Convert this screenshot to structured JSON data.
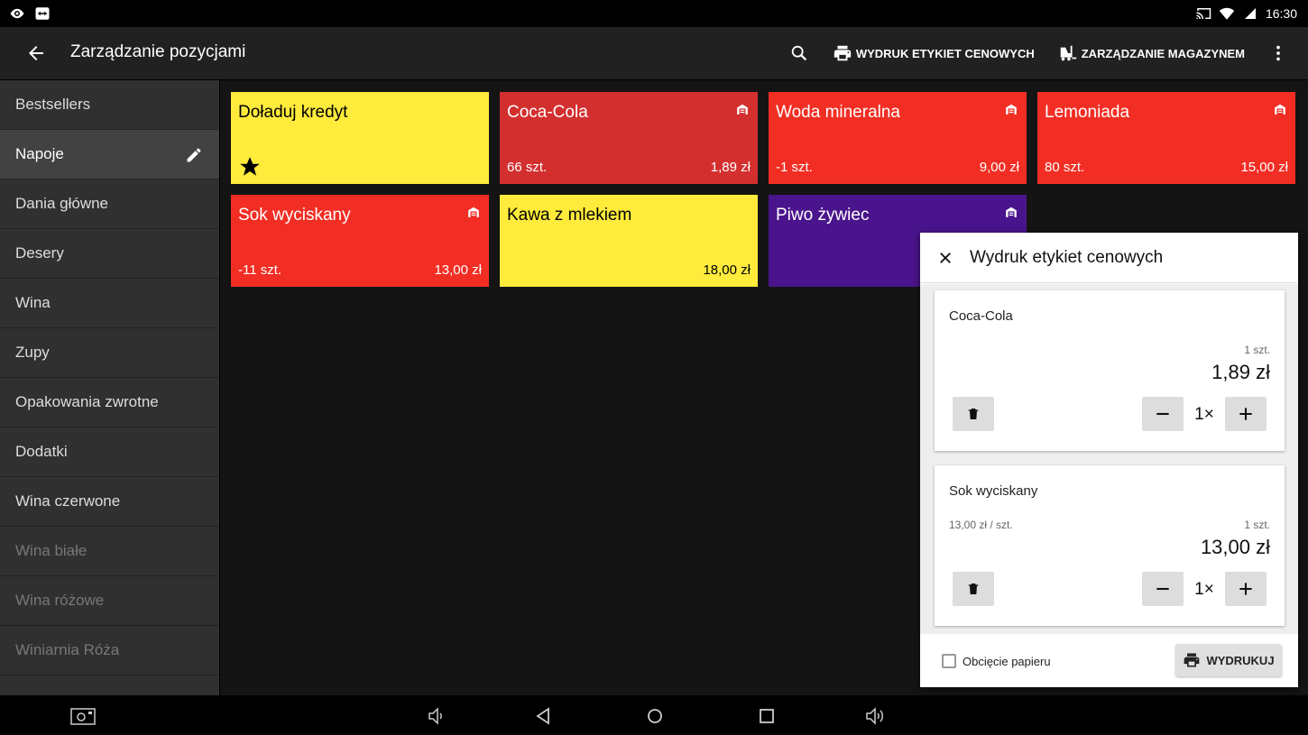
{
  "status": {
    "time": "16:30"
  },
  "appbar": {
    "title": "Zarządzanie pozycjami",
    "print_labels": "WYDRUK ETYKIET CENOWYCH",
    "warehouse": "ZARZĄDZANIE MAGAZYNEM"
  },
  "sidebar": {
    "items": [
      {
        "label": "Bestsellers"
      },
      {
        "label": "Napoje"
      },
      {
        "label": "Dania główne"
      },
      {
        "label": "Desery"
      },
      {
        "label": "Wina"
      },
      {
        "label": "Zupy"
      },
      {
        "label": "Opakowania zwrotne"
      },
      {
        "label": "Dodatki"
      },
      {
        "label": "Wina czerwone"
      },
      {
        "label": "Wina białe"
      },
      {
        "label": "Wina różowe"
      },
      {
        "label": "Winiarnia Róża"
      }
    ]
  },
  "tiles": [
    {
      "name": "Doładuj kredyt",
      "qty": "",
      "price": "",
      "color": "#FFEB3B"
    },
    {
      "name": "Coca-Cola",
      "qty": "66 szt.",
      "price": "1,89 zł",
      "color": "#D32F2F"
    },
    {
      "name": "Woda mineralna",
      "qty": "-1 szt.",
      "price": "9,00 zł",
      "color": "#F22E24"
    },
    {
      "name": "Lemoniada",
      "qty": "80 szt.",
      "price": "15,00 zł",
      "color": "#F22E24"
    },
    {
      "name": "Sok wyciskany",
      "qty": "-11 szt.",
      "price": "13,00 zł",
      "color": "#F22E24"
    },
    {
      "name": "Kawa z mlekiem",
      "qty": "",
      "price": "18,00 zł",
      "color": "#FFEB3B"
    },
    {
      "name": "Piwo żywiec",
      "qty": "",
      "price": "",
      "color": "#4A148C"
    }
  ],
  "panel": {
    "title": "Wydruk etykiet cenowych",
    "cards": [
      {
        "name": "Coca-Cola",
        "unit": "",
        "qty": "1 szt.",
        "total": "1,89 zł",
        "count": "1×"
      },
      {
        "name": "Sok wyciskany",
        "unit": "13,00 zł / szt.",
        "qty": "1 szt.",
        "total": "13,00 zł",
        "count": "1×"
      }
    ],
    "cut_paper": "Obcięcie papieru",
    "print_button": "WYDRUKUJ"
  }
}
